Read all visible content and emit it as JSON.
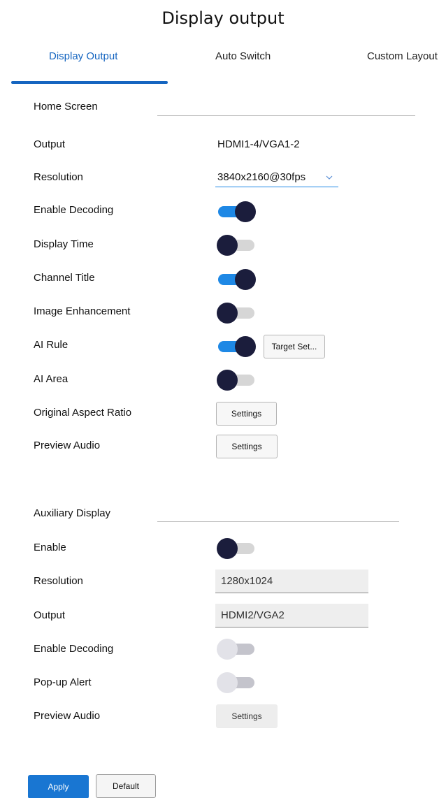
{
  "page": {
    "title": "Display output"
  },
  "tabs": [
    {
      "label": "Display Output",
      "active": true
    },
    {
      "label": "Auto Switch",
      "active": false
    },
    {
      "label": "Custom Layout",
      "active": false
    }
  ],
  "home_screen": {
    "title": "Home Screen",
    "output": {
      "label": "Output",
      "value": "HDMI1-4/VGA1-2"
    },
    "resolution": {
      "label": "Resolution",
      "value": "3840x2160@30fps"
    },
    "enable_decoding": {
      "label": "Enable Decoding",
      "state": "on"
    },
    "display_time": {
      "label": "Display Time",
      "state": "off"
    },
    "channel_title": {
      "label": "Channel Title",
      "state": "on"
    },
    "image_enhancement": {
      "label": "Image Enhancement",
      "state": "off"
    },
    "ai_rule": {
      "label": "AI Rule",
      "state": "on",
      "button_label": "Target Set..."
    },
    "ai_area": {
      "label": "AI Area",
      "state": "off"
    },
    "original_aspect_ratio": {
      "label": "Original Aspect Ratio",
      "button_label": "Settings"
    },
    "preview_audio": {
      "label": "Preview Audio",
      "button_label": "Settings"
    }
  },
  "auxiliary_display": {
    "title": "Auxiliary Display",
    "enable": {
      "label": "Enable",
      "state": "off"
    },
    "resolution": {
      "label": "Resolution",
      "value": "1280x1024"
    },
    "output": {
      "label": "Output",
      "value": "HDMI2/VGA2"
    },
    "enable_decoding": {
      "label": "Enable Decoding",
      "state": "disabled"
    },
    "popup_alert": {
      "label": "Pop-up Alert",
      "state": "disabled"
    },
    "preview_audio": {
      "label": "Preview Audio",
      "button_label": "Settings"
    }
  },
  "actions": {
    "apply_label": "Apply",
    "default_label": "Default"
  },
  "colors": {
    "accent": "#1976d2",
    "knob": "#1b1d3c",
    "track_off": "#d6d6d6",
    "disabled_knob": "#e2e2e8"
  },
  "icons": {
    "dropdown": "chevron-down-icon"
  }
}
